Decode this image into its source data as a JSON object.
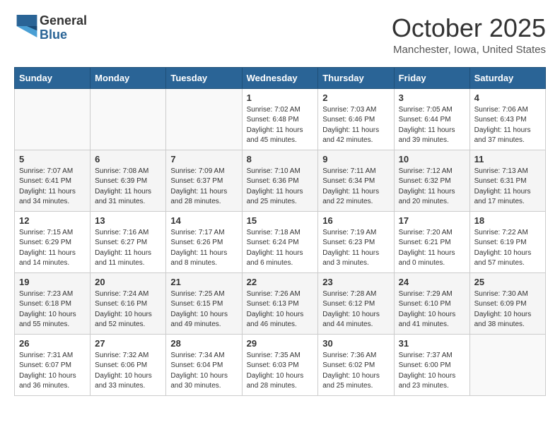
{
  "header": {
    "logo_line1": "General",
    "logo_line2": "Blue",
    "month_title": "October 2025",
    "location": "Manchester, Iowa, United States"
  },
  "weekdays": [
    "Sunday",
    "Monday",
    "Tuesday",
    "Wednesday",
    "Thursday",
    "Friday",
    "Saturday"
  ],
  "weeks": [
    [
      {
        "day": "",
        "info": ""
      },
      {
        "day": "",
        "info": ""
      },
      {
        "day": "",
        "info": ""
      },
      {
        "day": "1",
        "info": "Sunrise: 7:02 AM\nSunset: 6:48 PM\nDaylight: 11 hours\nand 45 minutes."
      },
      {
        "day": "2",
        "info": "Sunrise: 7:03 AM\nSunset: 6:46 PM\nDaylight: 11 hours\nand 42 minutes."
      },
      {
        "day": "3",
        "info": "Sunrise: 7:05 AM\nSunset: 6:44 PM\nDaylight: 11 hours\nand 39 minutes."
      },
      {
        "day": "4",
        "info": "Sunrise: 7:06 AM\nSunset: 6:43 PM\nDaylight: 11 hours\nand 37 minutes."
      }
    ],
    [
      {
        "day": "5",
        "info": "Sunrise: 7:07 AM\nSunset: 6:41 PM\nDaylight: 11 hours\nand 34 minutes."
      },
      {
        "day": "6",
        "info": "Sunrise: 7:08 AM\nSunset: 6:39 PM\nDaylight: 11 hours\nand 31 minutes."
      },
      {
        "day": "7",
        "info": "Sunrise: 7:09 AM\nSunset: 6:37 PM\nDaylight: 11 hours\nand 28 minutes."
      },
      {
        "day": "8",
        "info": "Sunrise: 7:10 AM\nSunset: 6:36 PM\nDaylight: 11 hours\nand 25 minutes."
      },
      {
        "day": "9",
        "info": "Sunrise: 7:11 AM\nSunset: 6:34 PM\nDaylight: 11 hours\nand 22 minutes."
      },
      {
        "day": "10",
        "info": "Sunrise: 7:12 AM\nSunset: 6:32 PM\nDaylight: 11 hours\nand 20 minutes."
      },
      {
        "day": "11",
        "info": "Sunrise: 7:13 AM\nSunset: 6:31 PM\nDaylight: 11 hours\nand 17 minutes."
      }
    ],
    [
      {
        "day": "12",
        "info": "Sunrise: 7:15 AM\nSunset: 6:29 PM\nDaylight: 11 hours\nand 14 minutes."
      },
      {
        "day": "13",
        "info": "Sunrise: 7:16 AM\nSunset: 6:27 PM\nDaylight: 11 hours\nand 11 minutes."
      },
      {
        "day": "14",
        "info": "Sunrise: 7:17 AM\nSunset: 6:26 PM\nDaylight: 11 hours\nand 8 minutes."
      },
      {
        "day": "15",
        "info": "Sunrise: 7:18 AM\nSunset: 6:24 PM\nDaylight: 11 hours\nand 6 minutes."
      },
      {
        "day": "16",
        "info": "Sunrise: 7:19 AM\nSunset: 6:23 PM\nDaylight: 11 hours\nand 3 minutes."
      },
      {
        "day": "17",
        "info": "Sunrise: 7:20 AM\nSunset: 6:21 PM\nDaylight: 11 hours\nand 0 minutes."
      },
      {
        "day": "18",
        "info": "Sunrise: 7:22 AM\nSunset: 6:19 PM\nDaylight: 10 hours\nand 57 minutes."
      }
    ],
    [
      {
        "day": "19",
        "info": "Sunrise: 7:23 AM\nSunset: 6:18 PM\nDaylight: 10 hours\nand 55 minutes."
      },
      {
        "day": "20",
        "info": "Sunrise: 7:24 AM\nSunset: 6:16 PM\nDaylight: 10 hours\nand 52 minutes."
      },
      {
        "day": "21",
        "info": "Sunrise: 7:25 AM\nSunset: 6:15 PM\nDaylight: 10 hours\nand 49 minutes."
      },
      {
        "day": "22",
        "info": "Sunrise: 7:26 AM\nSunset: 6:13 PM\nDaylight: 10 hours\nand 46 minutes."
      },
      {
        "day": "23",
        "info": "Sunrise: 7:28 AM\nSunset: 6:12 PM\nDaylight: 10 hours\nand 44 minutes."
      },
      {
        "day": "24",
        "info": "Sunrise: 7:29 AM\nSunset: 6:10 PM\nDaylight: 10 hours\nand 41 minutes."
      },
      {
        "day": "25",
        "info": "Sunrise: 7:30 AM\nSunset: 6:09 PM\nDaylight: 10 hours\nand 38 minutes."
      }
    ],
    [
      {
        "day": "26",
        "info": "Sunrise: 7:31 AM\nSunset: 6:07 PM\nDaylight: 10 hours\nand 36 minutes."
      },
      {
        "day": "27",
        "info": "Sunrise: 7:32 AM\nSunset: 6:06 PM\nDaylight: 10 hours\nand 33 minutes."
      },
      {
        "day": "28",
        "info": "Sunrise: 7:34 AM\nSunset: 6:04 PM\nDaylight: 10 hours\nand 30 minutes."
      },
      {
        "day": "29",
        "info": "Sunrise: 7:35 AM\nSunset: 6:03 PM\nDaylight: 10 hours\nand 28 minutes."
      },
      {
        "day": "30",
        "info": "Sunrise: 7:36 AM\nSunset: 6:02 PM\nDaylight: 10 hours\nand 25 minutes."
      },
      {
        "day": "31",
        "info": "Sunrise: 7:37 AM\nSunset: 6:00 PM\nDaylight: 10 hours\nand 23 minutes."
      },
      {
        "day": "",
        "info": ""
      }
    ]
  ]
}
